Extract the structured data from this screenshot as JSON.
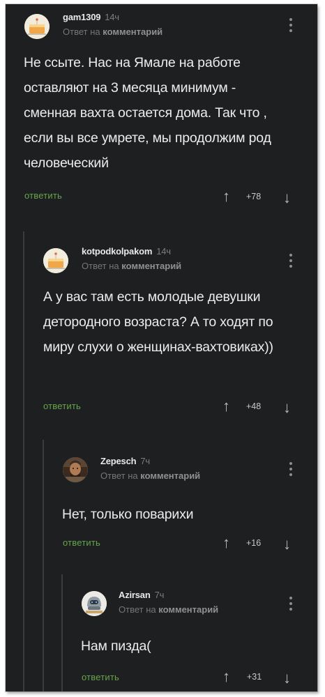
{
  "comments": [
    {
      "username": "gam1309",
      "time": "14ч",
      "reply_prefix": "Ответ на",
      "reply_target": "комментарий",
      "text": "Не ссыте. Нас на Ямале на работе оставляют на 3 месяца минимум - сменная вахта остается дома. Так что , если вы все умрете, мы продолжим род человеческий",
      "reply_label": "ответить",
      "rating": "+78",
      "avatar_icon": "cake-avatar-icon"
    },
    {
      "username": "kotpodkolpakom",
      "time": "14ч",
      "reply_prefix": "Ответ на",
      "reply_target": "комментарий",
      "text": "А у вас там есть молодые девушки детородного возраста? А то ходят по миру слухи о женщинах-вахтовиках))",
      "reply_label": "ответить",
      "rating": "+48",
      "avatar_icon": "cake-avatar-icon"
    },
    {
      "username": "Zepesch",
      "time": "7ч",
      "reply_prefix": "Ответ на",
      "reply_target": "комментарий",
      "text": "Нет, только поварихи",
      "reply_label": "ответить",
      "rating": "+16",
      "avatar_icon": "portrait-avatar-icon"
    },
    {
      "username": "Azirsan",
      "time": "7ч",
      "reply_prefix": "Ответ на",
      "reply_target": "комментарий",
      "text": "Нам пизда(",
      "reply_label": "ответить",
      "rating": "+31",
      "avatar_icon": "helmet-avatar-icon"
    }
  ],
  "colors": {
    "background": "#1e1f21",
    "reply_link": "#67a54b",
    "text": "#ececec",
    "meta": "#75767a"
  },
  "icons": {
    "menu": "more-vertical-icon",
    "upvote": "arrow-up-icon",
    "downvote": "arrow-down-icon"
  }
}
